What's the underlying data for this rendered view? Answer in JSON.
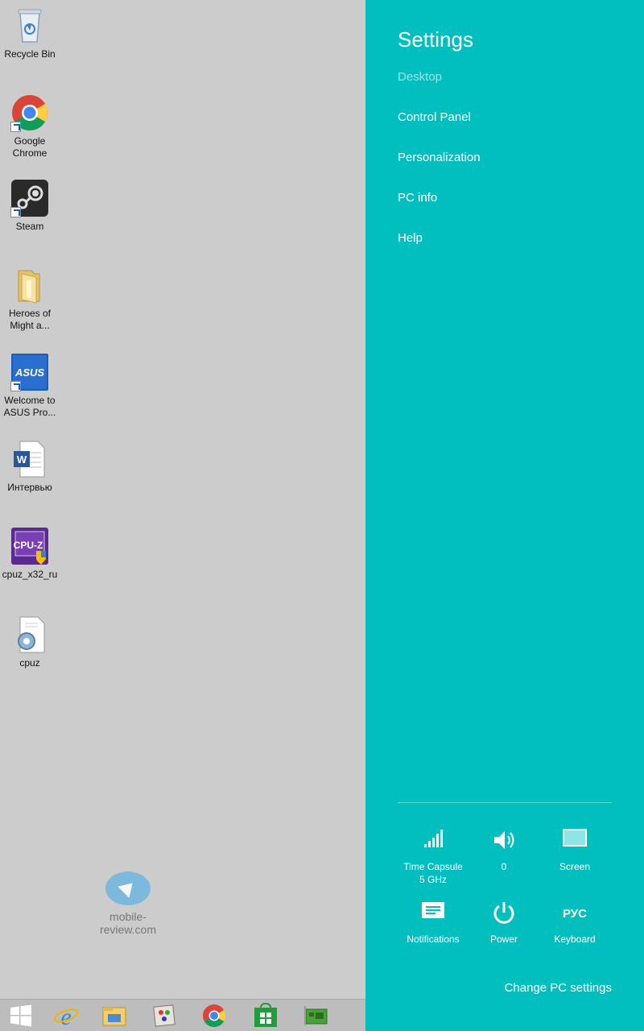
{
  "desktop": {
    "icons": [
      {
        "label": "Recycle Bin"
      },
      {
        "label": "Google Chrome"
      },
      {
        "label": "Steam"
      },
      {
        "label": "Heroes of Might a..."
      },
      {
        "label": "Welcome to ASUS Pro..."
      },
      {
        "label": "Интервью"
      },
      {
        "label": "cpuz_x32_ru"
      },
      {
        "label": "cpuz"
      }
    ],
    "watermark": "mobile-review.com"
  },
  "taskbar": {
    "items": [
      "start-icon",
      "internet-explorer-icon",
      "file-explorer-icon",
      "paint-icon",
      "chrome-icon",
      "store-icon",
      "network-card-icon"
    ]
  },
  "charm": {
    "title": "Settings",
    "items": [
      {
        "label": "Desktop"
      },
      {
        "label": "Control Panel"
      },
      {
        "label": "Personalization"
      },
      {
        "label": "PC info"
      },
      {
        "label": "Help"
      }
    ],
    "tiles": [
      {
        "label": "Time Capsule\n5 GHz",
        "line1": "Time Capsule",
        "line2": "5 GHz",
        "icon": "wifi-signal-icon"
      },
      {
        "label": "0",
        "icon": "volume-icon"
      },
      {
        "label": "Screen",
        "icon": "screen-brightness-icon"
      },
      {
        "label": "Notifications",
        "icon": "notifications-icon"
      },
      {
        "label": "Power",
        "icon": "power-icon"
      },
      {
        "label": "Keyboard",
        "icon_text": "РУС",
        "icon": "keyboard-language-icon"
      }
    ],
    "change_settings": "Change PC settings"
  },
  "colors": {
    "charm_bg": "#01bfbf",
    "desktop_bg": "#cccccc",
    "taskbar_bg": "#bdbdbd"
  }
}
